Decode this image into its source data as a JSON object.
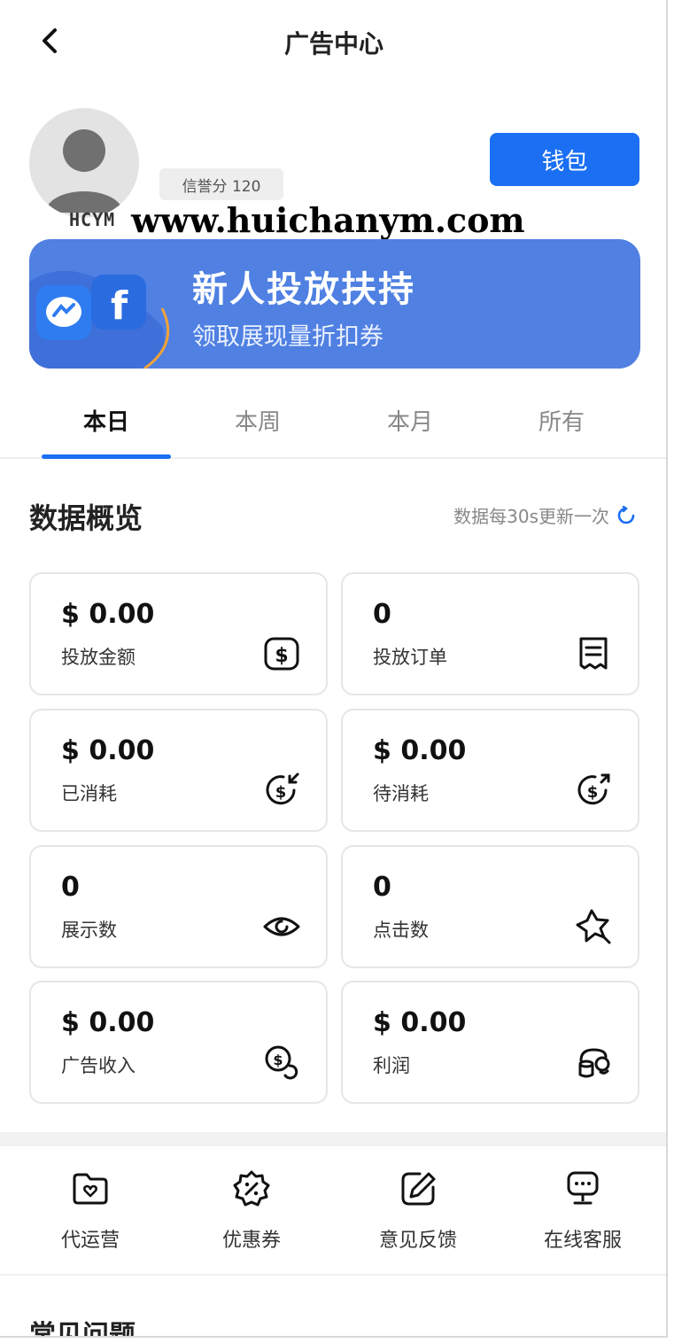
{
  "header": {
    "title": "广告中心"
  },
  "profile": {
    "credit_label": "信誉分 120",
    "wallet_label": "钱包"
  },
  "watermark": {
    "logo": "HCYM",
    "url": "www.huichanym.com"
  },
  "banner": {
    "heading": "新人投放扶持",
    "subheading": "领取展现量折扣券",
    "bg_color": "#4f80e2"
  },
  "tabs": [
    {
      "label": "本日",
      "active": true
    },
    {
      "label": "本周",
      "active": false
    },
    {
      "label": "本月",
      "active": false
    },
    {
      "label": "所有",
      "active": false
    }
  ],
  "overview": {
    "title": "数据概览",
    "update_note": "数据每30s更新一次",
    "cards": [
      {
        "value": "$ 0.00",
        "label": "投放金额",
        "icon": "dollar-box-icon"
      },
      {
        "value": "0",
        "label": "投放订单",
        "icon": "receipt-icon"
      },
      {
        "value": "$ 0.00",
        "label": "已消耗",
        "icon": "dollar-in-icon"
      },
      {
        "value": "$ 0.00",
        "label": "待消耗",
        "icon": "dollar-out-icon"
      },
      {
        "value": "0",
        "label": "展示数",
        "icon": "eye-icon"
      },
      {
        "value": "0",
        "label": "点击数",
        "icon": "click-star-icon"
      },
      {
        "value": "$ 0.00",
        "label": "广告收入",
        "icon": "coin-icon"
      },
      {
        "value": "$ 0.00",
        "label": "利润",
        "icon": "coin-stack-icon"
      }
    ]
  },
  "quick_actions": [
    {
      "label": "代运营",
      "icon": "folder-heart-icon"
    },
    {
      "label": "优惠券",
      "icon": "discount-badge-icon"
    },
    {
      "label": "意见反馈",
      "icon": "edit-pen-icon"
    },
    {
      "label": "在线客服",
      "icon": "chat-monitor-icon"
    }
  ],
  "faq": {
    "title": "常见问题"
  },
  "colors": {
    "accent": "#1a6ff2",
    "card_border": "#e6e6e6"
  }
}
